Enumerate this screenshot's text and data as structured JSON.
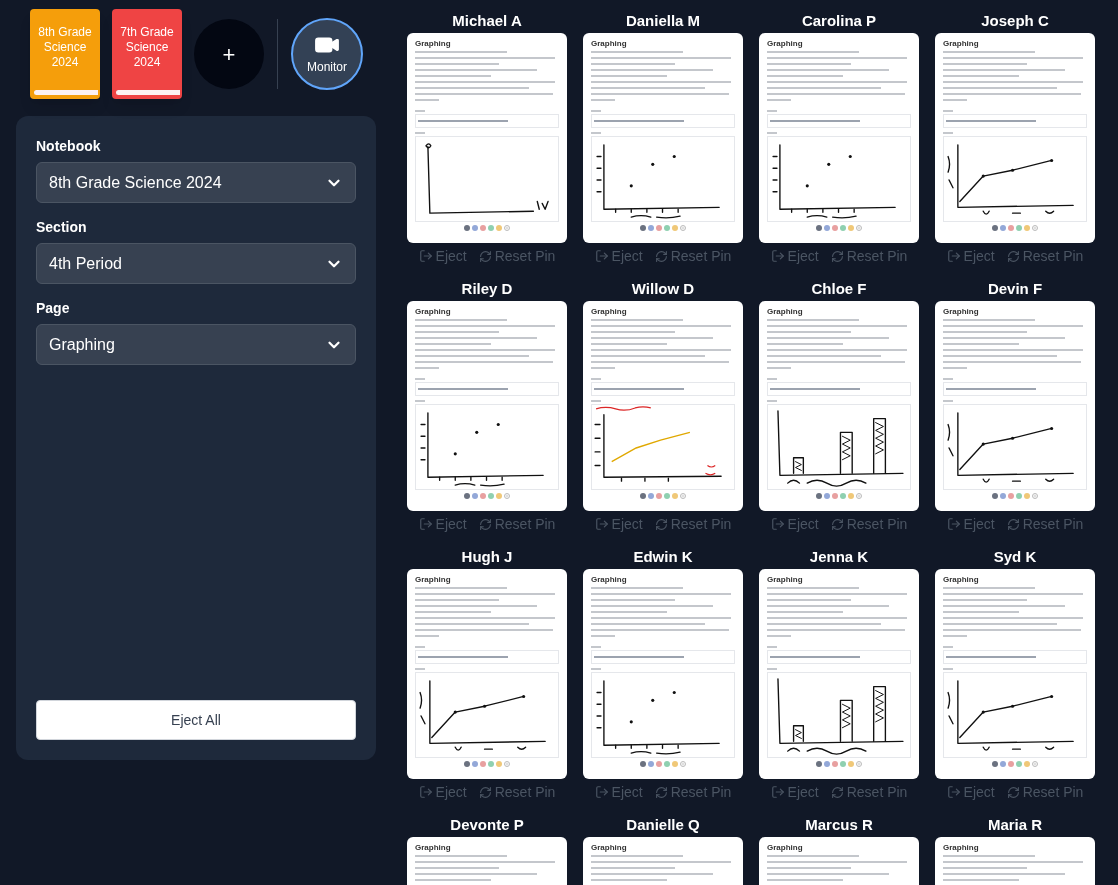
{
  "notebooks": [
    {
      "label": "8th Grade Science 2024",
      "color": "#f59e0b"
    },
    {
      "label": "7th Grade Science 2024",
      "color": "#ef4444"
    }
  ],
  "add_button": {
    "label": "+"
  },
  "monitor": {
    "label": "Monitor",
    "active": true
  },
  "filters": [
    {
      "label": "Notebook",
      "value": "8th Grade Science 2024"
    },
    {
      "label": "Section",
      "value": "4th Period"
    },
    {
      "label": "Page",
      "value": "Graphing"
    }
  ],
  "eject_all": {
    "label": "Eject All"
  },
  "palette": [
    {
      "color": "#6b7280"
    },
    {
      "color": "#93a8d8"
    },
    {
      "color": "#e8a0a0"
    },
    {
      "color": "#8fd0b0"
    },
    {
      "color": "#f0c878"
    }
  ],
  "cards": [
    {
      "name": "Michael A",
      "page_title": "Graphing",
      "graph": {
        "kind": "axes"
      },
      "actions": [
        {
          "label": "Eject",
          "kind": "eject",
          "disabled": true
        },
        {
          "label": "Reset Pin",
          "kind": "reset",
          "disabled": true
        }
      ]
    },
    {
      "name": "Daniella M",
      "page_title": "Graphing",
      "graph": {
        "kind": "scatter"
      },
      "actions": [
        {
          "label": "Eject",
          "kind": "eject",
          "disabled": true
        },
        {
          "label": "Reset Pin",
          "kind": "reset",
          "disabled": true
        }
      ]
    },
    {
      "name": "Carolina P",
      "page_title": "Graphing",
      "graph": {
        "kind": "scatter"
      },
      "actions": [
        {
          "label": "Eject",
          "kind": "eject",
          "disabled": true
        },
        {
          "label": "Reset Pin",
          "kind": "reset",
          "disabled": true
        }
      ]
    },
    {
      "name": "Joseph C",
      "page_title": "Graphing",
      "graph": {
        "kind": "line"
      },
      "actions": [
        {
          "label": "Eject",
          "kind": "eject",
          "disabled": true
        },
        {
          "label": "Reset Pin",
          "kind": "reset",
          "disabled": true
        }
      ]
    },
    {
      "name": "Riley D",
      "page_title": "Graphing",
      "graph": {
        "kind": "scatter"
      },
      "actions": [
        {
          "label": "Eject",
          "kind": "eject",
          "disabled": true
        },
        {
          "label": "Reset Pin",
          "kind": "reset",
          "disabled": true
        }
      ]
    },
    {
      "name": "Willow D",
      "page_title": "Graphing",
      "graph": {
        "kind": "colored-line"
      },
      "actions": [
        {
          "label": "Eject",
          "kind": "eject",
          "disabled": true
        },
        {
          "label": "Reset Pin",
          "kind": "reset",
          "disabled": true
        }
      ]
    },
    {
      "name": "Chloe F",
      "page_title": "Graphing",
      "graph": {
        "kind": "bar"
      },
      "actions": [
        {
          "label": "Eject",
          "kind": "eject",
          "disabled": true
        },
        {
          "label": "Reset Pin",
          "kind": "reset",
          "disabled": true
        }
      ]
    },
    {
      "name": "Devin F",
      "page_title": "Graphing",
      "graph": {
        "kind": "line"
      },
      "actions": [
        {
          "label": "Eject",
          "kind": "eject",
          "disabled": true
        },
        {
          "label": "Reset Pin",
          "kind": "reset",
          "disabled": true
        }
      ]
    },
    {
      "name": "Hugh J",
      "page_title": "Graphing",
      "graph": {
        "kind": "line"
      },
      "actions": [
        {
          "label": "Eject",
          "kind": "eject",
          "disabled": true
        },
        {
          "label": "Reset Pin",
          "kind": "reset",
          "disabled": true
        }
      ]
    },
    {
      "name": "Edwin K",
      "page_title": "Graphing",
      "graph": {
        "kind": "scatter"
      },
      "actions": [
        {
          "label": "Eject",
          "kind": "eject",
          "disabled": true
        },
        {
          "label": "Reset Pin",
          "kind": "reset",
          "disabled": true
        }
      ]
    },
    {
      "name": "Jenna K",
      "page_title": "Graphing",
      "graph": {
        "kind": "bar"
      },
      "actions": [
        {
          "label": "Eject",
          "kind": "eject",
          "disabled": true
        },
        {
          "label": "Reset Pin",
          "kind": "reset",
          "disabled": true
        }
      ]
    },
    {
      "name": "Syd K",
      "page_title": "Graphing",
      "graph": {
        "kind": "line"
      },
      "actions": [
        {
          "label": "Eject",
          "kind": "eject",
          "disabled": true
        },
        {
          "label": "Reset Pin",
          "kind": "reset",
          "disabled": true
        }
      ]
    },
    {
      "name": "Devonte P",
      "page_title": "Graphing"
    },
    {
      "name": "Danielle Q",
      "page_title": "Graphing"
    },
    {
      "name": "Marcus R",
      "page_title": "Graphing"
    },
    {
      "name": "Maria R",
      "page_title": "Graphing"
    }
  ]
}
